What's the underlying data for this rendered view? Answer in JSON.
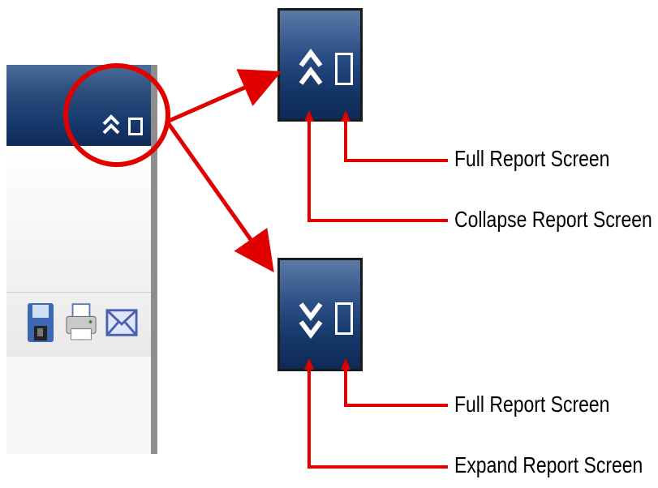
{
  "labels": {
    "full_top": "Full Report Screen",
    "collapse": "Collapse Report Screen",
    "full_bottom": "Full Report Screen",
    "expand": "Expand Report Screen"
  },
  "icons": {
    "collapse": "double-chevron-up-icon",
    "expand": "double-chevron-down-icon",
    "full": "full-screen-square-icon",
    "save": "floppy-disk-icon",
    "print": "printer-icon",
    "email": "envelope-icon"
  },
  "colors": {
    "annotation": "#e10000",
    "titlebar": "#173a6e"
  }
}
